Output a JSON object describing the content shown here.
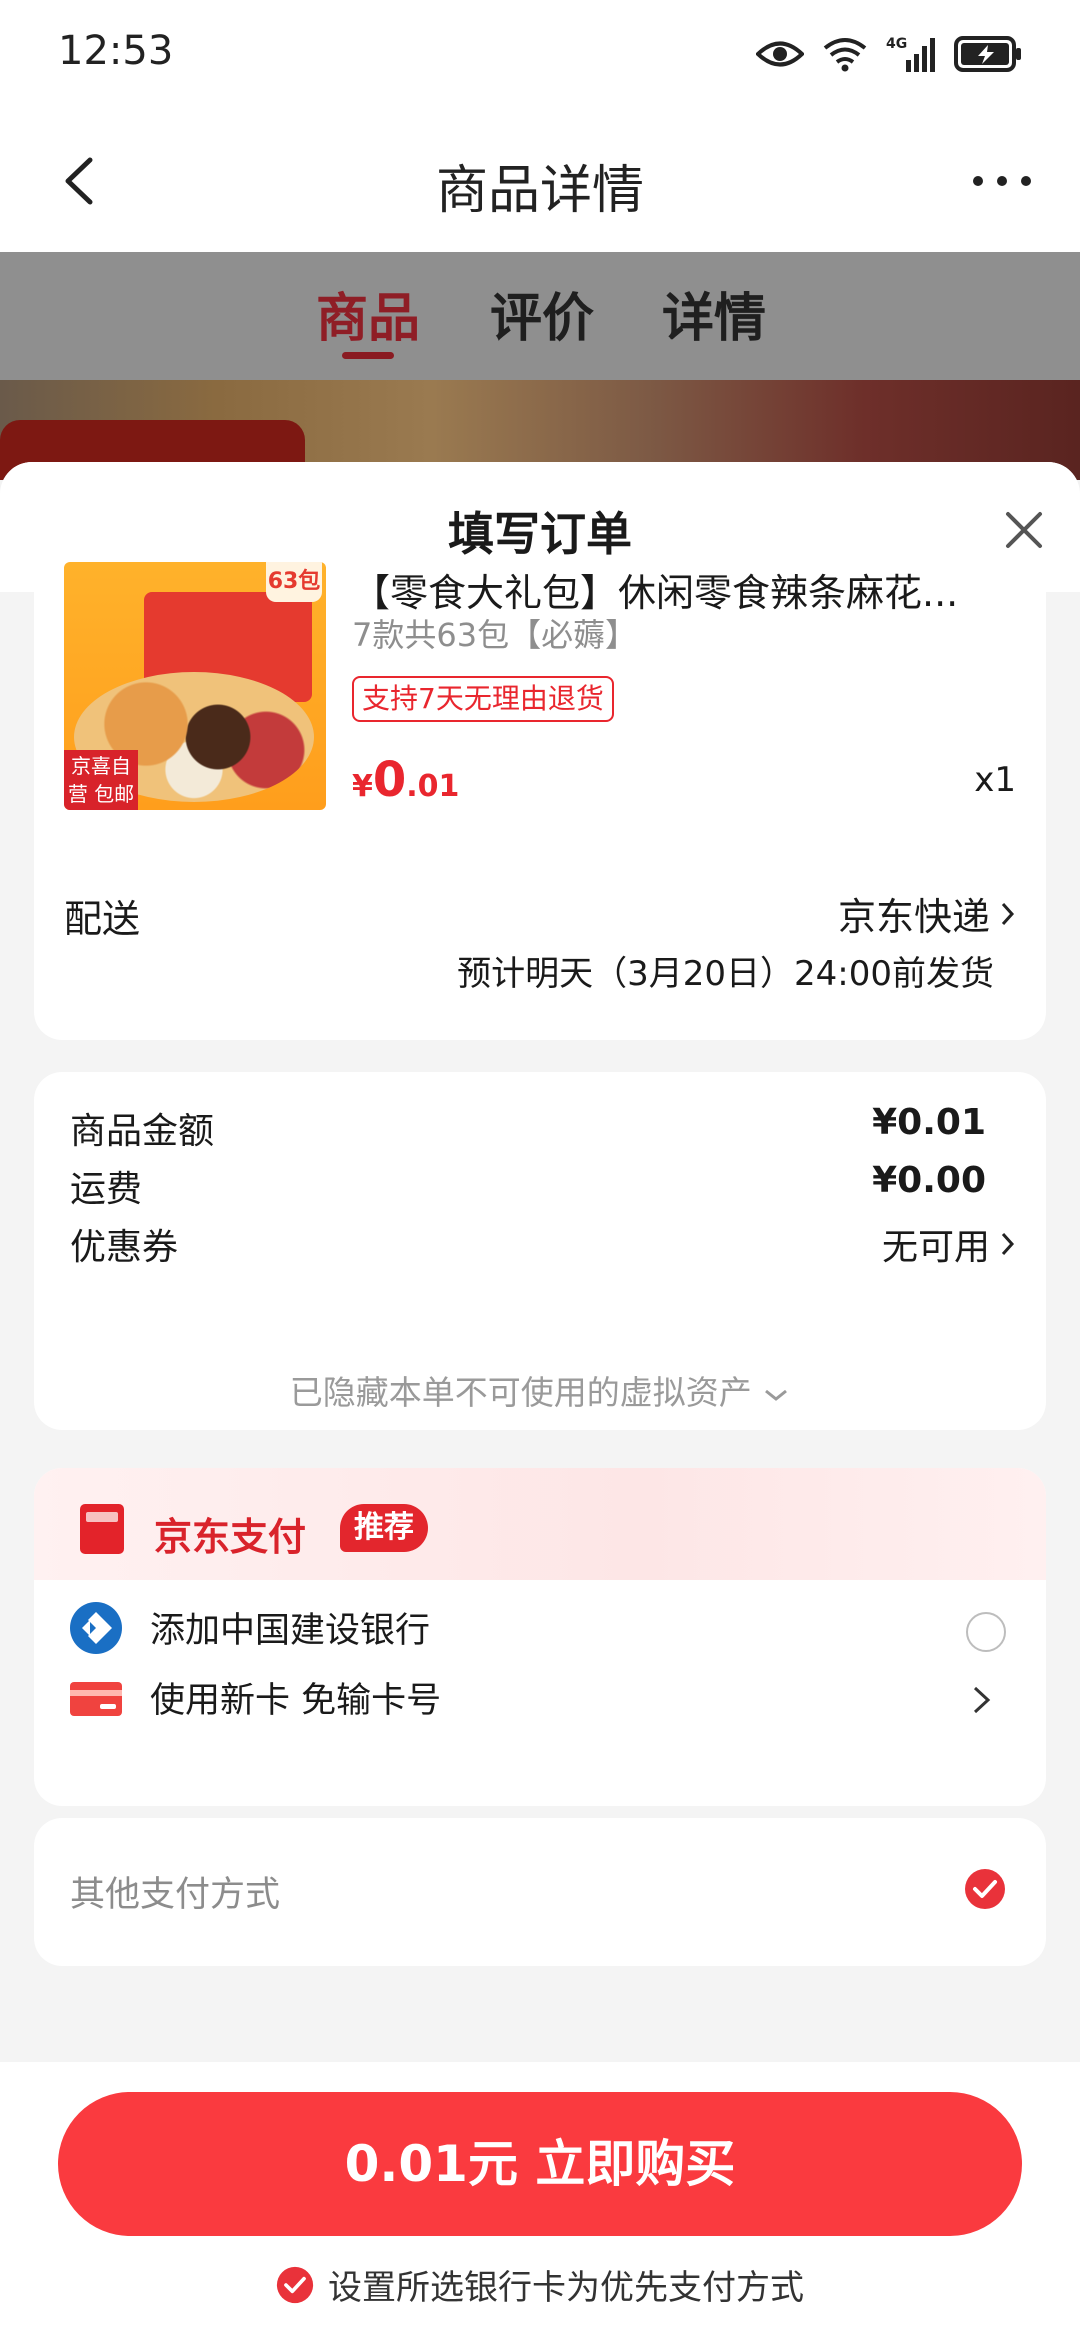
{
  "status_bar": {
    "time": "12:53",
    "network": "4G"
  },
  "nav": {
    "title": "商品详情"
  },
  "tabs": [
    {
      "label": "商品",
      "active": true
    },
    {
      "label": "评价",
      "active": false
    },
    {
      "label": "详情",
      "active": false
    }
  ],
  "sheet": {
    "title": "填写订单",
    "product": {
      "name": "【零食大礼包】休闲零食辣条麻花...",
      "spec": "7款共63包【必薅】",
      "return_policy": "支持7天无理由退货",
      "image_count_badge": "63包",
      "image_tag": "京喜自营 包邮",
      "price_symbol": "¥",
      "price_int": "0",
      "price_dec": ".01",
      "quantity": "x1"
    },
    "delivery": {
      "label": "配送",
      "method": "京东快递",
      "estimate": "预计明天（3月20日）24:00前发货"
    },
    "fees": {
      "items_label": "商品金额",
      "items_value": "¥0.01",
      "shipping_label": "运费",
      "shipping_value": "¥0.00",
      "coupon_label": "优惠券",
      "coupon_value": "无可用",
      "hidden_assets_note": "已隐藏本单不可使用的虚拟资产"
    },
    "payment": {
      "provider": "京东支付",
      "badge": "推荐",
      "options": [
        {
          "label": "添加中国建设银行",
          "selected": false
        },
        {
          "label": "使用新卡 免输卡号"
        }
      ],
      "other_label": "其他支付方式",
      "other_selected": true
    }
  },
  "bottom": {
    "buy_label": "0.01元 立即购买",
    "preference_label": "设置所选银行卡为优先支付方式",
    "preference_checked": true
  },
  "colors": {
    "accent": "#fa3a3f",
    "brand_red": "#e3232a",
    "tab_active": "#8f1e26"
  }
}
